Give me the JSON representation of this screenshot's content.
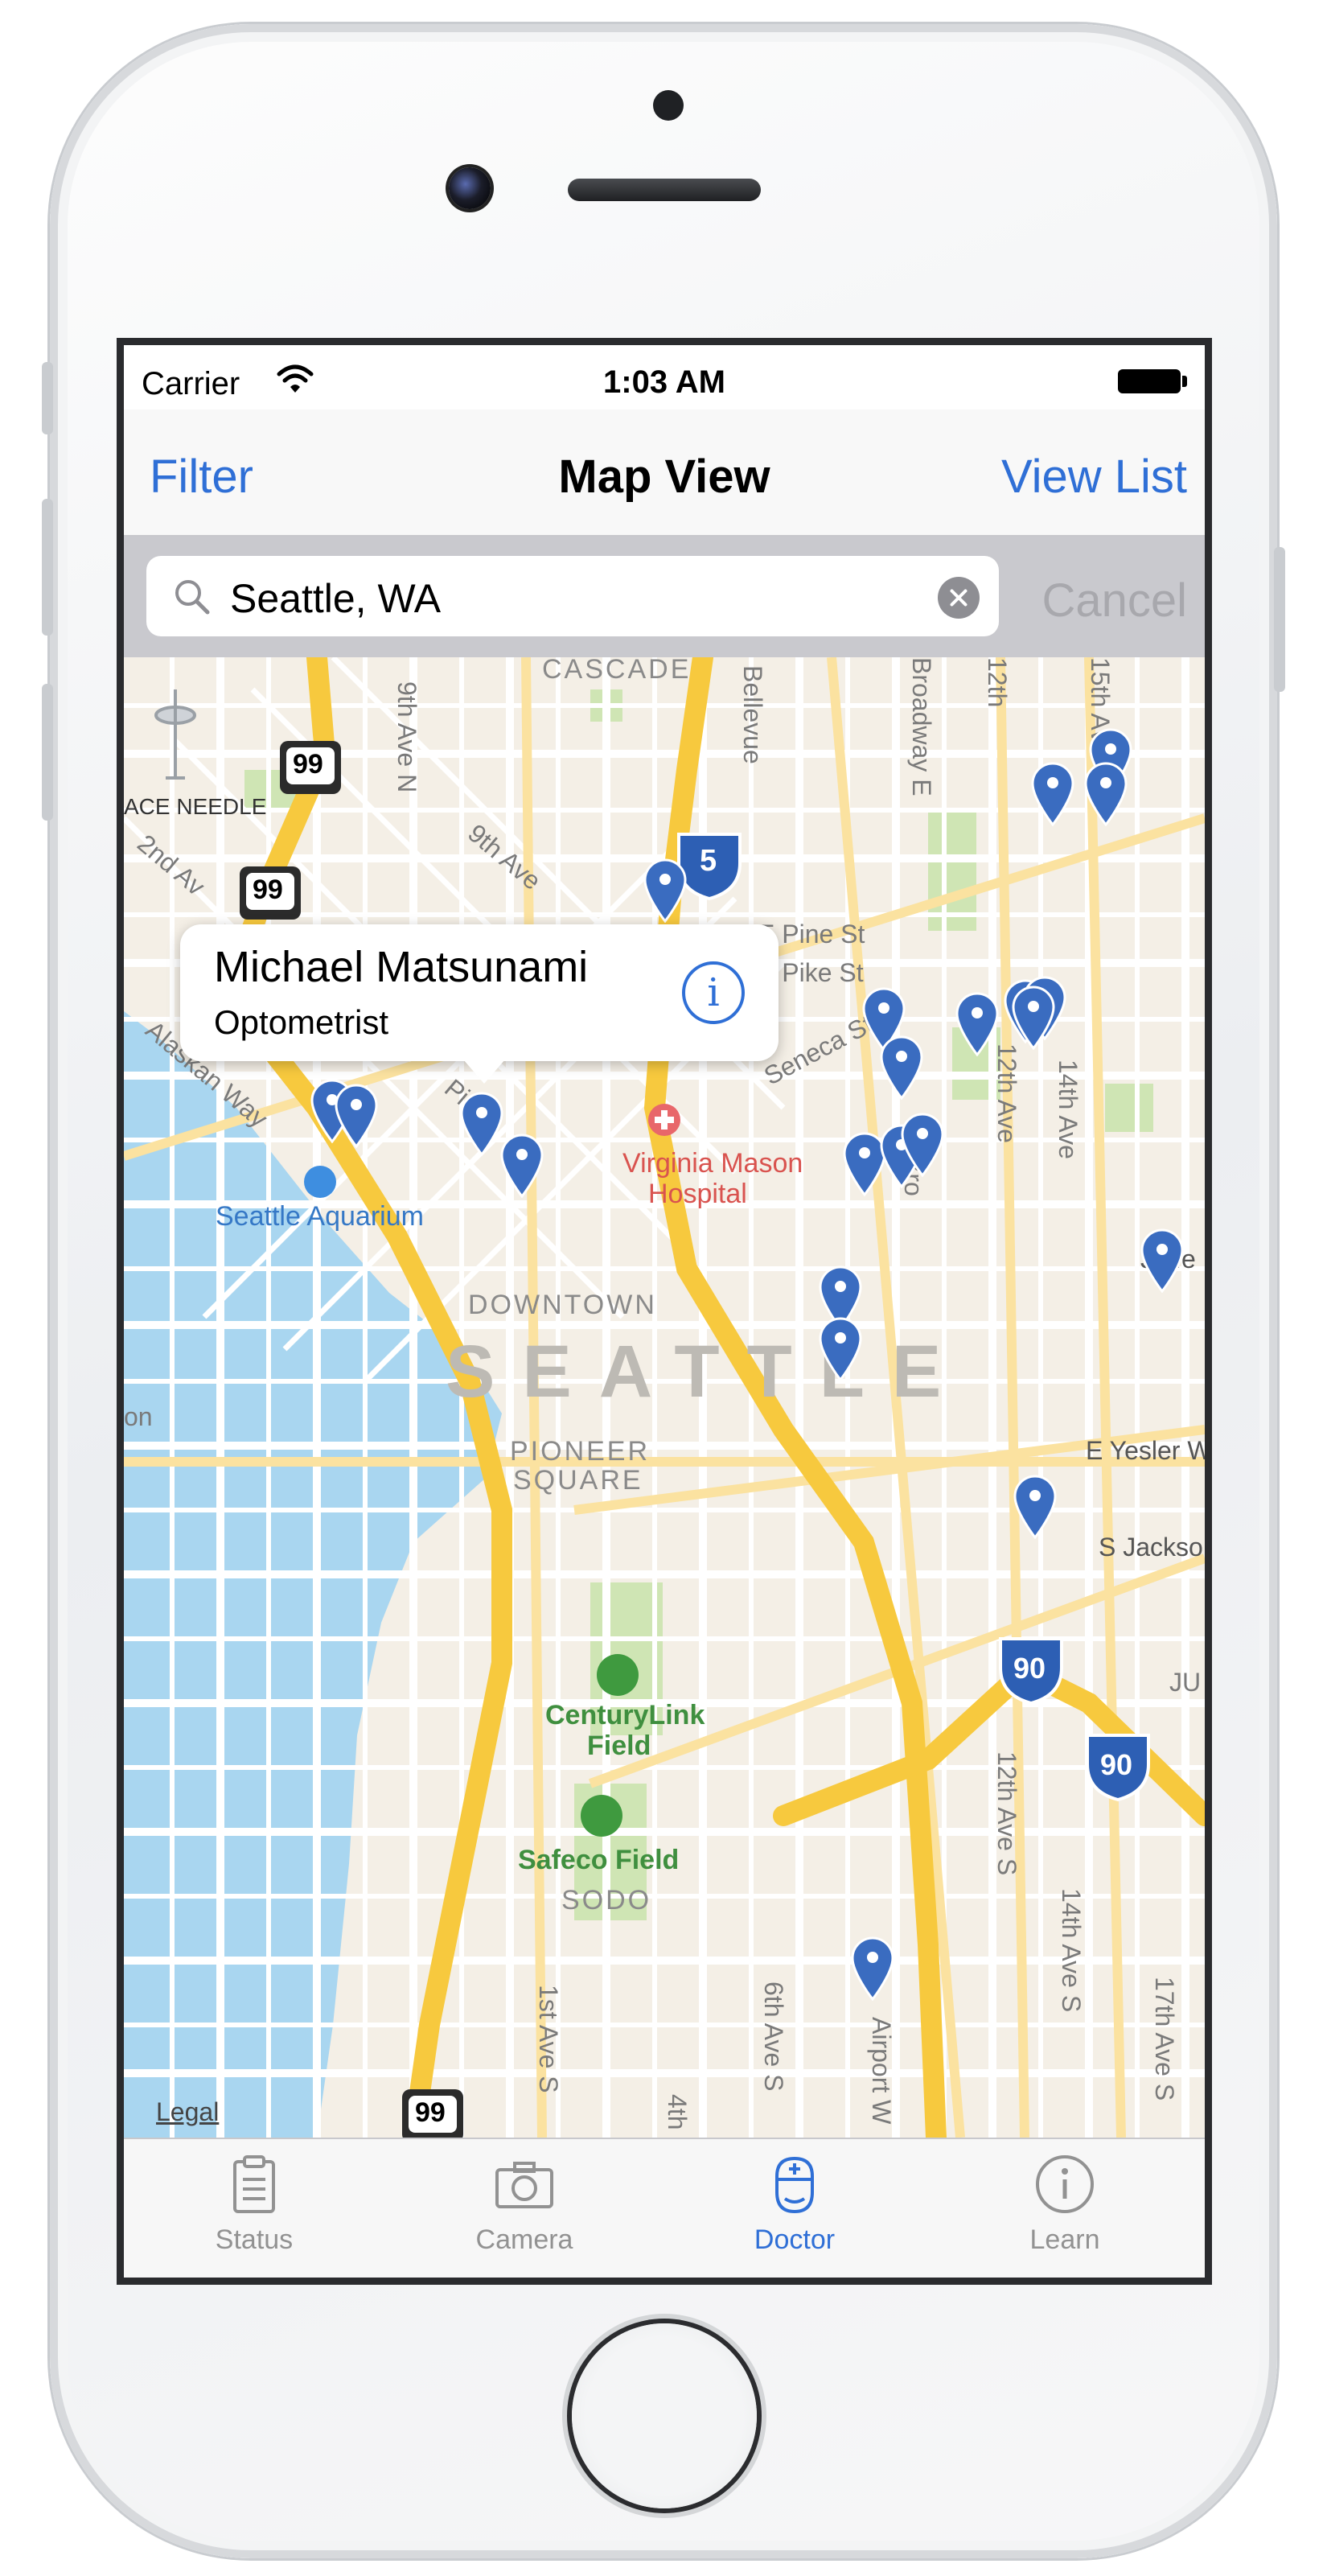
{
  "status_bar": {
    "carrier": "Carrier",
    "time": "1:03 AM"
  },
  "nav": {
    "left": "Filter",
    "title": "Map View",
    "right": "View List"
  },
  "search": {
    "value": "Seattle, WA",
    "cancel": "Cancel"
  },
  "callout": {
    "name": "Michael Matsunami",
    "role": "Optometrist"
  },
  "map": {
    "legal": "Legal",
    "labels": {
      "cascade": "CASCADE",
      "space_needle": "ACE NEEDLE",
      "bellevue": "Bellevue",
      "ninth_ave_n": "9th Ave N",
      "ninth_ave": "9th Ave",
      "second_ave": "2nd Av",
      "broadway_e": "Broadway E",
      "twelfth_top": "12th",
      "fifteenth": "15th Ave",
      "pine": "E Pine St",
      "pike": "E Pike St",
      "seneca": "Seneca St",
      "alaskan": "Alaskan Way",
      "pike_pl": "Pi",
      "virginia_mason": "Virginia Mason",
      "hospital": "Hospital",
      "broadway": "Bro",
      "twelfth_ave": "12th Ave",
      "fourteenth_ave": "14th Ave",
      "aquarium": "Seattle Aquarium",
      "downtown": "DOWNTOWN",
      "seattle": "SEATTLE",
      "pioneer": "PIONEER",
      "square": "SQUARE",
      "yesler": "E Yesler W",
      "jackson": "S Jackso",
      "jefferson": "Jeffe",
      "on": "on",
      "centurylink": "CenturyLink",
      "field1": "Field",
      "safeco": "Safeco Field",
      "sodo": "SODO",
      "twelfth_ave_s": "12th Ave S",
      "fourteenth_ave_s": "14th Ave S",
      "seventeenth_ave_s": "17th Ave S",
      "first_ave_s": "1st Ave S",
      "fourth": "4th",
      "sixth_ave_s": "6th Ave S",
      "airport": "Airport W",
      "ju": "JU",
      "shield_99": "99",
      "shield_5": "5",
      "shield_90": "90"
    }
  },
  "tabs": [
    {
      "label": "Status",
      "icon": "clipboard-icon",
      "active": false
    },
    {
      "label": "Camera",
      "icon": "camera-icon",
      "active": false
    },
    {
      "label": "Doctor",
      "icon": "doctor-icon",
      "active": true
    },
    {
      "label": "Learn",
      "icon": "info-icon",
      "active": false
    }
  ],
  "colors": {
    "accent": "#2f6fd6",
    "pin": "#3a6cc0",
    "water": "#a9d6f0",
    "highway": "#f7c93e",
    "park": "#cfe5b4"
  }
}
